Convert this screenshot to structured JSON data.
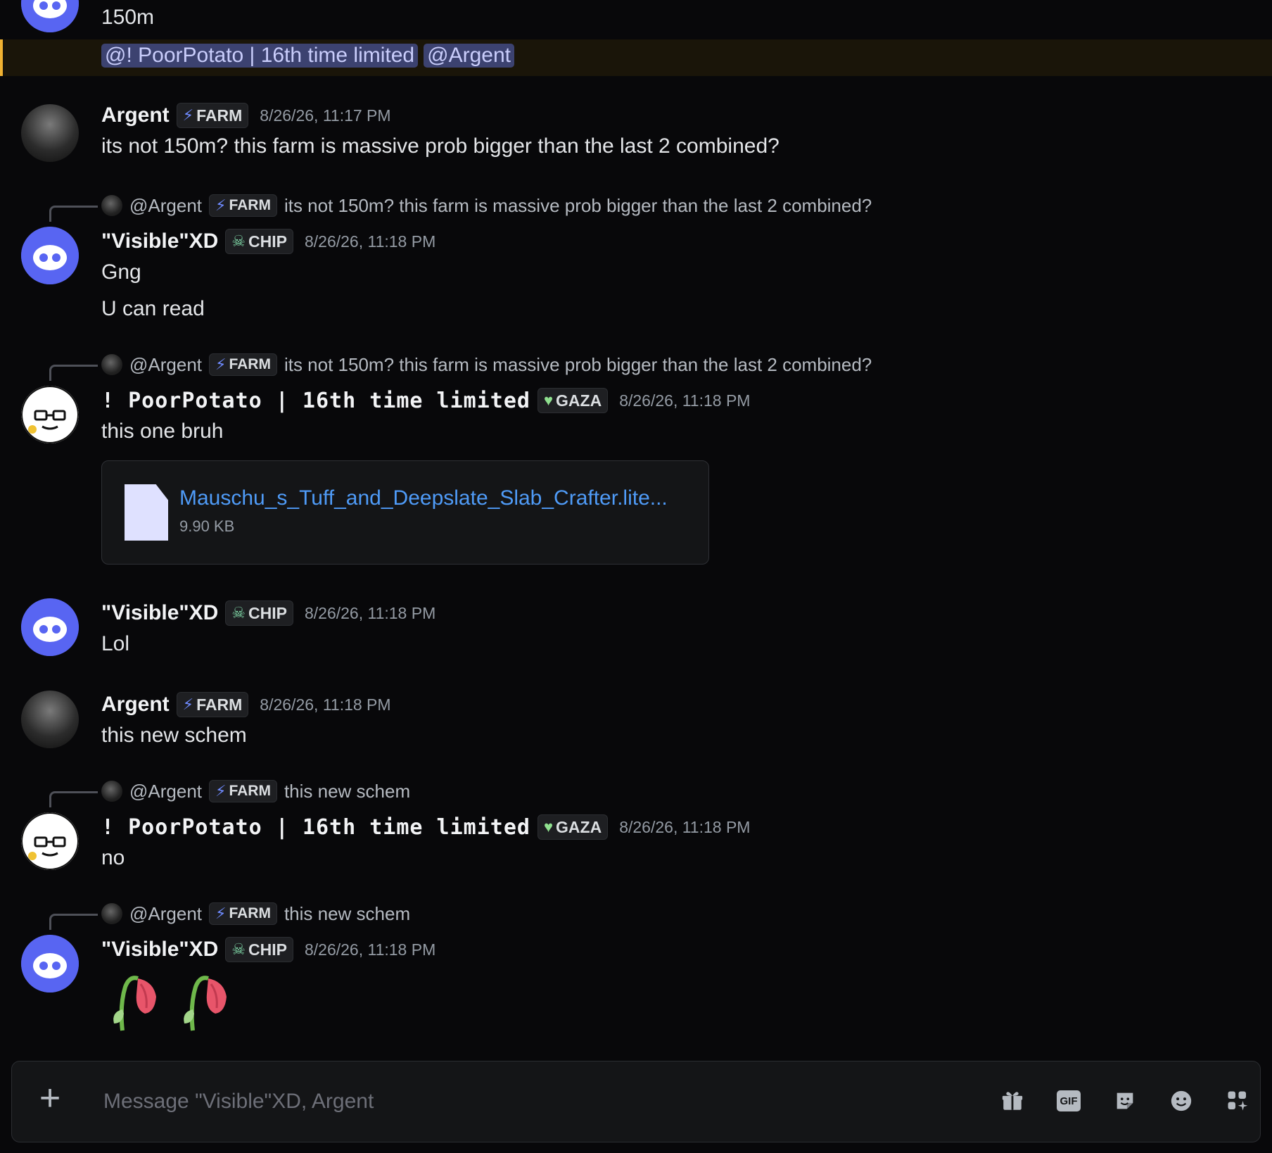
{
  "messages": {
    "m0": {
      "text": "150m",
      "mentions": [
        "@! PoorPotato | 16th time limited",
        "@Argent"
      ]
    },
    "m1": {
      "author": "Argent",
      "role": "FARM",
      "time": "8/26/26, 11:17 PM",
      "text": "its not 150m? this farm is massive prob bigger than the last 2 combined?"
    },
    "m2": {
      "reply": {
        "mention": "@Argent",
        "role": "FARM",
        "snippet": "its not 150m? this farm is massive prob bigger than the last 2 combined?"
      },
      "author": "\"Visible\"XD",
      "role": "CHIP",
      "time": "8/26/26, 11:18 PM",
      "lines": [
        "Gng",
        "U can read"
      ]
    },
    "m3": {
      "reply": {
        "mention": "@Argent",
        "role": "FARM",
        "snippet": "its not 150m? this farm is massive prob bigger than the last 2 combined?"
      },
      "author": "! PoorPotato | 16th time limited",
      "role": "GAZA",
      "time": "8/26/26, 11:18 PM",
      "text": "this one bruh",
      "attachment": {
        "name": "Mauschu_s_Tuff_and_Deepslate_Slab_Crafter.lite...",
        "size": "9.90 KB"
      }
    },
    "m4": {
      "author": "\"Visible\"XD",
      "role": "CHIP",
      "time": "8/26/26, 11:18 PM",
      "text": "Lol"
    },
    "m5": {
      "author": "Argent",
      "role": "FARM",
      "time": "8/26/26, 11:18 PM",
      "text": "this new schem"
    },
    "m6": {
      "reply": {
        "mention": "@Argent",
        "role": "FARM",
        "snippet": "this new schem"
      },
      "author": "! PoorPotato | 16th time limited",
      "role": "GAZA",
      "time": "8/26/26, 11:18 PM",
      "text": "no"
    },
    "m7": {
      "reply": {
        "mention": "@Argent",
        "role": "FARM",
        "snippet": "this new schem"
      },
      "author": "\"Visible\"XD",
      "role": "CHIP",
      "time": "8/26/26, 11:18 PM",
      "emoji": [
        "wilted-flower",
        "wilted-flower"
      ]
    }
  },
  "composer": {
    "placeholder": "Message \"Visible\"XD, Argent"
  },
  "icons": {
    "role_farm": "lightning-icon",
    "role_chip": "skull-icon",
    "role_gaza": "green-heart-icon",
    "toolbar": [
      "gift-icon",
      "gif-icon",
      "sticker-icon",
      "emoji-icon",
      "apps-icon"
    ]
  },
  "colors": {
    "accent": "#5865f2",
    "link": "#4f9bf7",
    "mention_bg": "#3c4270",
    "highlight_bar": "#f0b232"
  }
}
